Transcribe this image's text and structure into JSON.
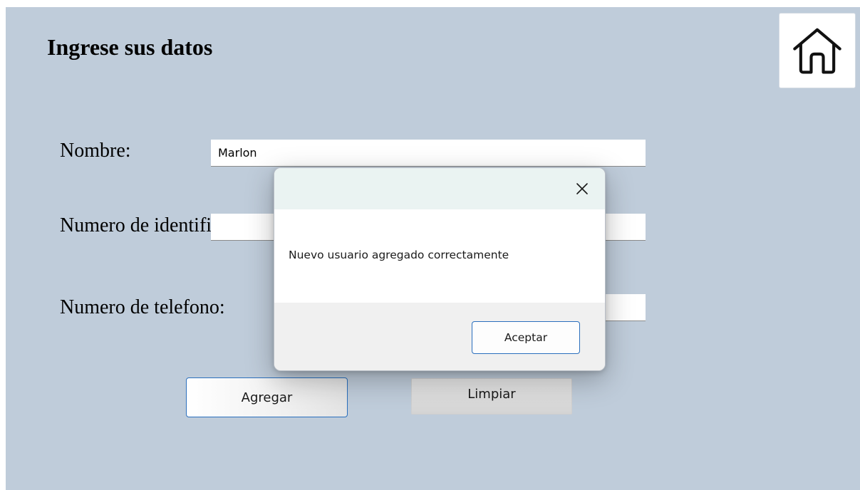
{
  "form": {
    "title": "Ingrese sus datos",
    "nombre_label": "Nombre:",
    "nombre_value": "Marlon",
    "identificacion_label": "Numero de identificacion:",
    "identificacion_value": "",
    "telefono_label": "Numero de telefono:",
    "telefono_value": "",
    "agregar_label": "Agregar",
    "limpiar_label": "Limpiar"
  },
  "header": {
    "home_icon": "home-icon"
  },
  "dialog": {
    "message": "Nuevo usuario agregado correctamente",
    "accept_label": "Aceptar",
    "close_icon": "close-icon"
  },
  "colors": {
    "background": "#bfccda",
    "accent_border": "#2a6fbd",
    "dialog_titlebar": "#eaf3f2",
    "dialog_footer": "#f0f0f0"
  }
}
